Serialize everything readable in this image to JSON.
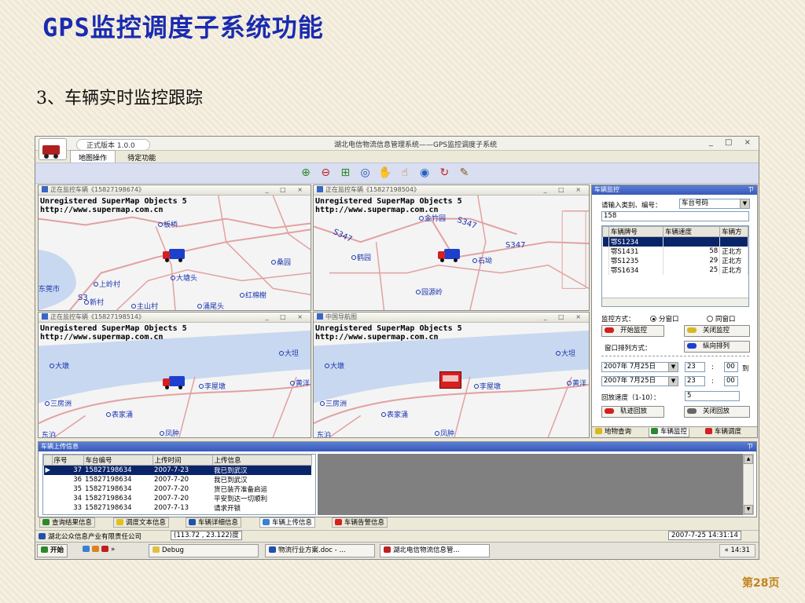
{
  "slide": {
    "title": "GPS监控调度子系统功能",
    "subtitle": "3、车辆实时监控跟踪",
    "page": "第28页"
  },
  "app": {
    "version": "正式版本 1.0.0",
    "window_title": "湖北电信物流信息管理系统——GPS监控调度子系统",
    "window_controls": "_ □ ×",
    "menu_tabs": [
      "地图操作",
      "待定功能"
    ]
  },
  "toolbar": {
    "icons": [
      "zoom-in-icon",
      "zoom-out-icon",
      "zoom-window-icon",
      "full-map-icon",
      "pan-hand-icon",
      "select-hand-icon",
      "globe-icon",
      "refresh-icon",
      "measure-icon"
    ]
  },
  "maps": [
    {
      "header": "正在监控车辆《15827198674》",
      "watermark1": "Unregistered SuperMap Objects 5",
      "watermark2": "http://www.supermap.com.cn",
      "places": [
        "板桥",
        "桑园",
        "大塘头",
        "上岭村",
        "东莞市",
        "S3",
        "新村",
        "主山村",
        "红棉榭",
        "涌尾头"
      ]
    },
    {
      "header": "正在监控车辆《15827198504》",
      "watermark1": "Unregistered SuperMap Objects 5",
      "watermark2": "http://www.supermap.com.cn",
      "places": [
        "金竹园",
        "S347",
        "S347",
        "鹤园",
        "S347",
        "石坳",
        "园源岭"
      ]
    },
    {
      "header": "正在监控车辆《15827198514》",
      "watermark1": "Unregistered SuperMap Objects 5",
      "watermark2": "http://www.supermap.com.cn",
      "places": [
        "大坦",
        "大墩",
        "李屋墩",
        "黄洋",
        "三房洲",
        "表家涌",
        "东泊",
        "凤肿"
      ]
    },
    {
      "header": "中国导航图",
      "watermark1": "Unregistered SuperMap Objects 5",
      "watermark2": "http://www.supermap.com.cn",
      "places": [
        "大坦",
        "大墩",
        "李屋墩",
        "黄洋",
        "三房洲",
        "表家涌",
        "东泊",
        "凤肿"
      ]
    }
  ],
  "map_header_controls": "_ □ ×",
  "monitor": {
    "header": "车辆监控",
    "pin": "ㄗ",
    "search_label": "请输入类别、编号：",
    "category": "车台号码",
    "search_value": "158",
    "columns": [
      "车辆牌号",
      "车辆速度",
      "车辆方"
    ],
    "rows": [
      [
        "鄂S1234",
        "",
        ""
      ],
      [
        "鄂S1431",
        "58",
        "正北方"
      ],
      [
        "鄂S1235",
        "29",
        "正北方"
      ],
      [
        "鄂S1634",
        "25",
        "正北方"
      ]
    ],
    "mode_label": "监控方式：",
    "mode_split": "分窗口",
    "mode_same": "同窗口",
    "start_btn": "开始监控",
    "close_btn": "关闭监控",
    "arrange_label": "窗口排列方式：",
    "arrange_btn": "纵向排列",
    "date1": "2007年 7月25日",
    "hour1": "23",
    "min1": "00",
    "to": "到",
    "date2": "2007年 7月25日",
    "hour2": "23",
    "min2": "00",
    "colon": ":",
    "speed_label": "回放速度（1-10）：",
    "speed_value": "5",
    "replay_btn": "轨迹回放",
    "close_replay_btn": "关闭回放",
    "tabs": [
      "地物查询",
      "车辆监控",
      "车辆调度"
    ]
  },
  "upload": {
    "header": "车辆上传信息",
    "pin": "ㄗ",
    "columns": [
      "序号",
      "车台编号",
      "上传时间",
      "上传信息"
    ],
    "rows": [
      [
        "37",
        "15827198634",
        "2007-7-23",
        "我已到武汉"
      ],
      [
        "36",
        "15827198634",
        "2007-7-20",
        "我已到武汉"
      ],
      [
        "35",
        "15827198634",
        "2007-7-20",
        "货已装齐准备启运"
      ],
      [
        "34",
        "15827198634",
        "2007-7-20",
        "平安到达一切顺利"
      ],
      [
        "33",
        "15827198634",
        "2007-7-13",
        "请求开锁"
      ]
    ],
    "tabs": [
      "查询结果信息",
      "调度文本信息",
      "车辆详细信息",
      "车辆上传信息",
      "车辆告警信息"
    ]
  },
  "status": {
    "company": "湖北公众信息产业有限责任公司",
    "coords": "(113.72 , 23.122)度",
    "datetime": "2007-7-25 14:31:14"
  },
  "taskbar": {
    "start": "开始",
    "chev": "»",
    "items": [
      "Debug",
      "物流行业方案.doc - ...",
      "湖北电信物流信息管..."
    ],
    "time": "« 14:31"
  }
}
